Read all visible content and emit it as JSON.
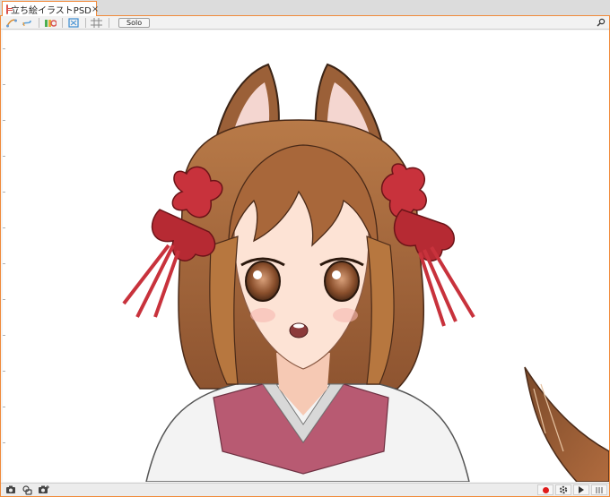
{
  "tab": {
    "title": "立ち絵イラストPSD",
    "close": "×"
  },
  "toolbar": {
    "solo_label": "Solo"
  },
  "colors": {
    "accent": "#f08a3a",
    "hair": "#a8673a",
    "ribbon": "#c8323c",
    "kimono": "#b85a72",
    "record": "#e01b1b"
  },
  "icons": {
    "toolbar": [
      "curve-tool-icon",
      "link-icon",
      "palette-icon",
      "fit-view-icon",
      "grid-icon"
    ],
    "status_left": [
      "camera-icon",
      "snapshot-icon",
      "camera-plus-icon"
    ],
    "status_right": [
      "record-icon",
      "settings-icon",
      "play-icon",
      "timeline-icon"
    ]
  }
}
